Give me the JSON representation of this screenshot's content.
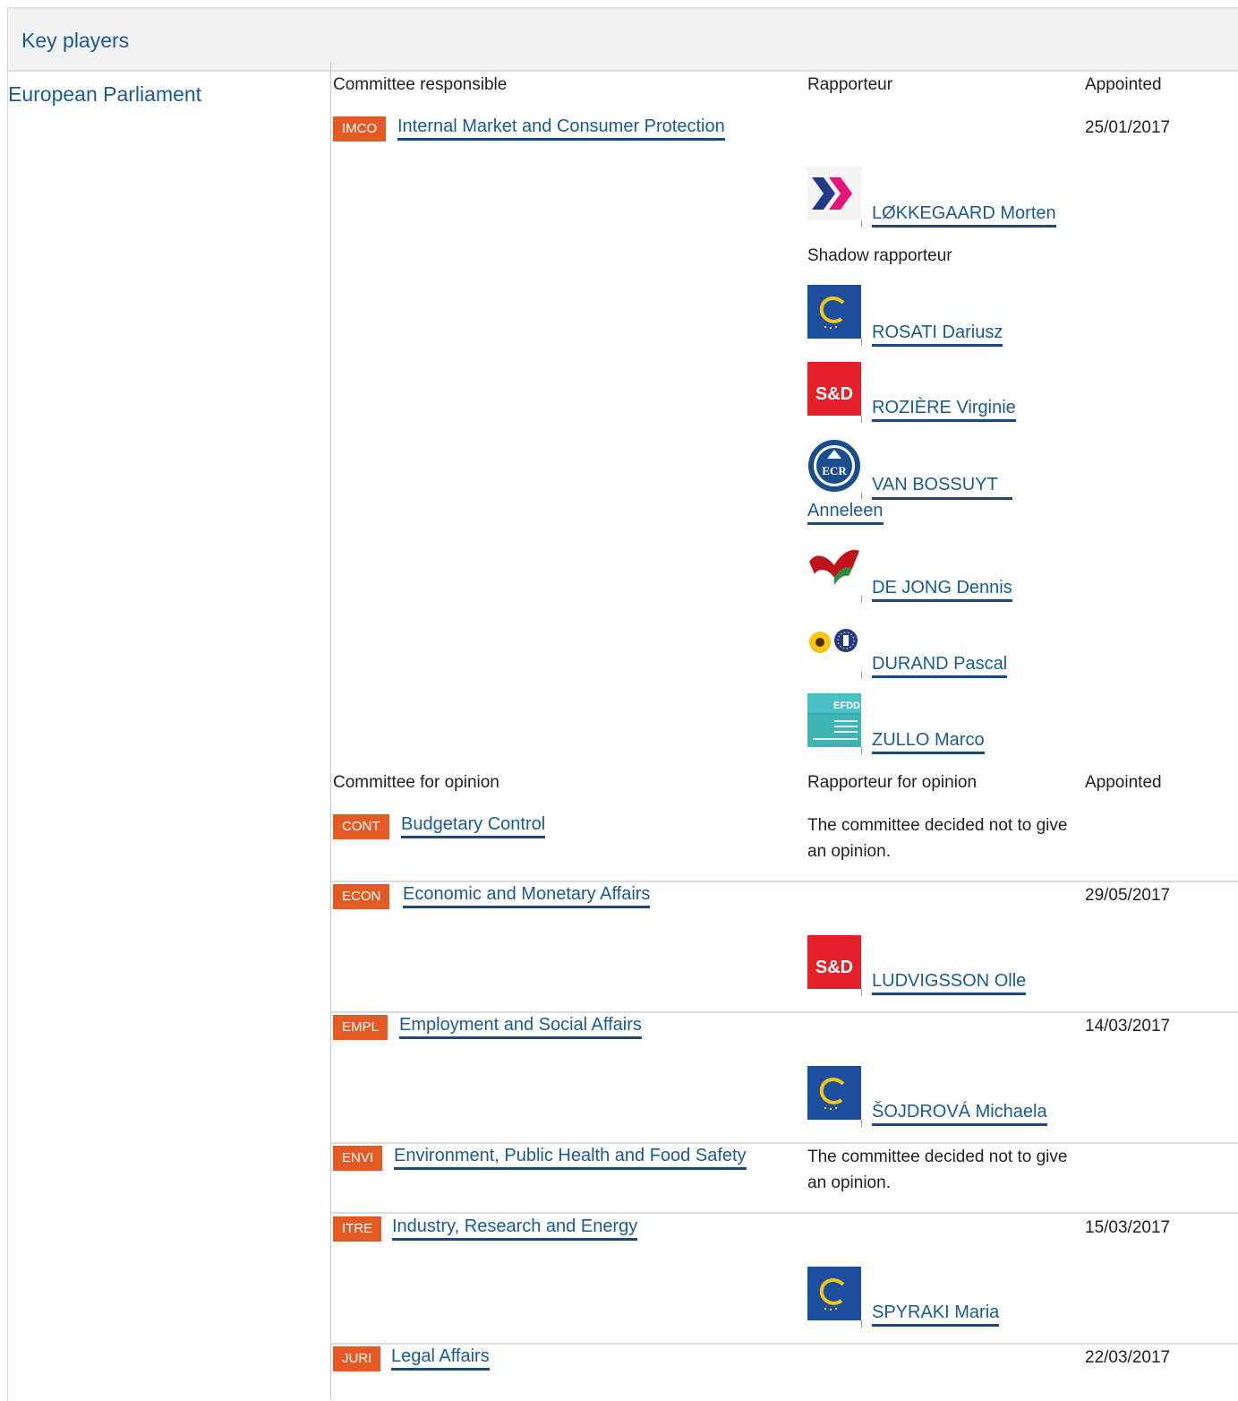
{
  "section": {
    "title": "Key players"
  },
  "institution": "European Parliament",
  "responsible": {
    "header": {
      "committee": "Committee responsible",
      "rapporteur": "Rapporteur",
      "appointed": "Appointed"
    },
    "code": "IMCO",
    "name": "Internal Market and Consumer Protection",
    "appointed": "25/01/2017",
    "rapporteur": {
      "name": "LØKKEGAARD Morten",
      "group_icon": "alde-logo"
    },
    "shadow_label": "Shadow rapporteur",
    "shadows": [
      {
        "name": "ROSATI Dariusz",
        "group_icon": "epp-logo"
      },
      {
        "name": "ROZIÈRE Virginie",
        "group_icon": "sd-logo",
        "logo_text": "S&D"
      },
      {
        "name_line1": "VAN BOSSUYT",
        "name_line2": "Anneleen",
        "group_icon": "ecr-logo",
        "logo_text": "ECR"
      },
      {
        "name": "DE JONG Dennis",
        "group_icon": "gue-ngl-logo"
      },
      {
        "name": "DURAND Pascal",
        "group_icon": "greens-efa-logo"
      },
      {
        "name": "ZULLO Marco",
        "group_icon": "efdd-logo",
        "logo_text": "EFDD"
      }
    ]
  },
  "opinion": {
    "header": {
      "committee": "Committee for opinion",
      "rapporteur": "Rapporteur for opinion",
      "appointed": "Appointed"
    },
    "committees": [
      {
        "code": "CONT",
        "name": "Budgetary Control",
        "note": "The committee decided not to give an opinion."
      },
      {
        "code": "ECON",
        "name": "Economic and Monetary Affairs",
        "appointed": "29/05/2017",
        "rapporteur": "LUDVIGSSON Olle",
        "group_icon": "sd-logo",
        "logo_text": "S&D"
      },
      {
        "code": "EMPL",
        "name": "Employment and Social Affairs",
        "appointed": "14/03/2017",
        "rapporteur": "ŠOJDROVÁ Michaela",
        "group_icon": "epp-logo"
      },
      {
        "code": "ENVI",
        "name": "Environment, Public Health and Food Safety",
        "note": "The committee decided not to give an opinion."
      },
      {
        "code": "ITRE",
        "name": "Industry, Research and Energy",
        "appointed": "15/03/2017",
        "rapporteur": "SPYRAKI Maria",
        "group_icon": "epp-logo"
      },
      {
        "code": "JURI",
        "name": "Legal Affairs",
        "appointed": "22/03/2017"
      }
    ]
  },
  "colors": {
    "link": "#1a5a96",
    "badge": "#e35a24",
    "header_bg": "#f2f2f2"
  }
}
